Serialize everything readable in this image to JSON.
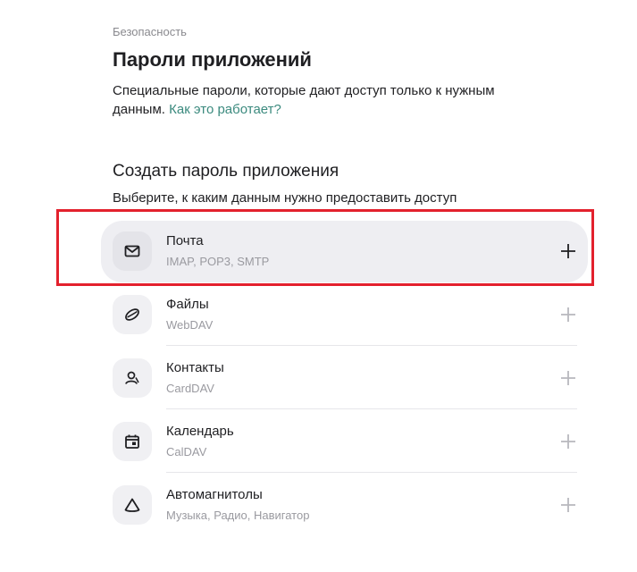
{
  "header": {
    "breadcrumb": "Безопасность",
    "title": "Пароли приложений",
    "description": "Специальные пароли, которые дают доступ только к нужным данным.",
    "help_link": "Как это работает?"
  },
  "section": {
    "title": "Создать пароль приложения",
    "subtitle": "Выберите, к каким данным нужно предоставить доступ"
  },
  "items": [
    {
      "label": "Почта",
      "sub": "IMAP, POP3, SMTP",
      "icon": "mail-icon",
      "selected": true
    },
    {
      "label": "Файлы",
      "sub": "WebDAV",
      "icon": "disk-icon",
      "selected": false
    },
    {
      "label": "Контакты",
      "sub": "CardDAV",
      "icon": "contacts-icon",
      "selected": false
    },
    {
      "label": "Календарь",
      "sub": "CalDAV",
      "icon": "calendar-icon",
      "selected": false
    },
    {
      "label": "Автомагнитолы",
      "sub": "Музыка, Радио, Навигатор",
      "icon": "car-audio-icon",
      "selected": false
    }
  ],
  "colors": {
    "accent_link": "#3b8a7e",
    "highlight_border": "#e3212d",
    "selected_row_bg": "#eeeef2"
  }
}
